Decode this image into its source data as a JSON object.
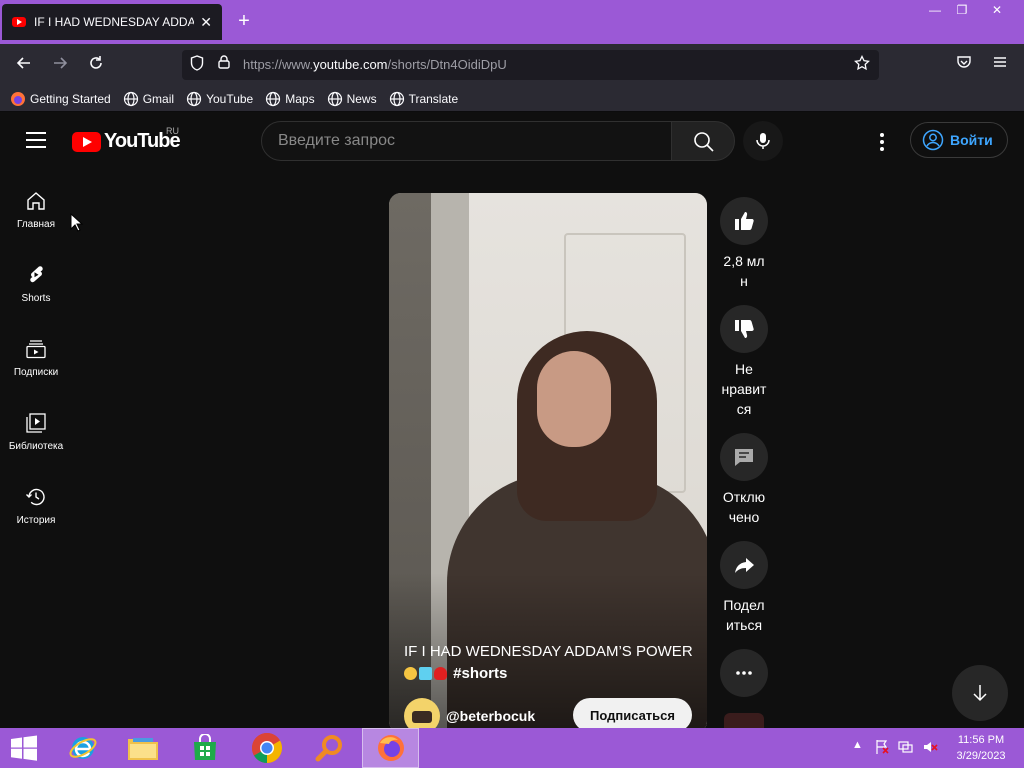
{
  "browser": {
    "tab_title": "IF I HAD WEDNESDAY ADDAMS",
    "url_prefix": "https://www.",
    "url_host": "youtube.com",
    "url_path": "/shorts/Dtn4OidiDpU",
    "new_tab": "+",
    "window": {
      "minimize": "—",
      "restore": "❐",
      "close": "✕"
    },
    "bookmarks": [
      "Getting Started",
      "Gmail",
      "YouTube",
      "Maps",
      "News",
      "Translate"
    ]
  },
  "youtube": {
    "logo_text": "YouTube",
    "region": "RU",
    "search_placeholder": "Введите запрос",
    "login_label": "Войти",
    "sidebar": [
      {
        "label": "Главная",
        "icon": "home-icon"
      },
      {
        "label": "Shorts",
        "icon": "shorts-icon"
      },
      {
        "label": "Подписки",
        "icon": "subscriptions-icon"
      },
      {
        "label": "Библиотека",
        "icon": "library-icon"
      },
      {
        "label": "История",
        "icon": "history-icon"
      }
    ],
    "short": {
      "title": "IF I HAD WEDNESDAY ADDAM’S POWER",
      "hashtag": "#shorts",
      "channel": "@beterbocuk",
      "subscribe_label": "Подписаться"
    },
    "actions": {
      "like": [
        "2,8 мл",
        "н"
      ],
      "dislike": [
        "Не",
        "нравит",
        "ся"
      ],
      "comments": [
        "Отклю",
        "чено"
      ],
      "share": [
        "Подел",
        "иться"
      ]
    }
  },
  "taskbar": {
    "time": "11:56 PM",
    "date": "3/29/2023"
  },
  "colors": {
    "browser_purple": "#9b59d6",
    "youtube_red": "#ff0000",
    "link_blue": "#3ea6ff",
    "page_bg": "#0f0f0f"
  }
}
